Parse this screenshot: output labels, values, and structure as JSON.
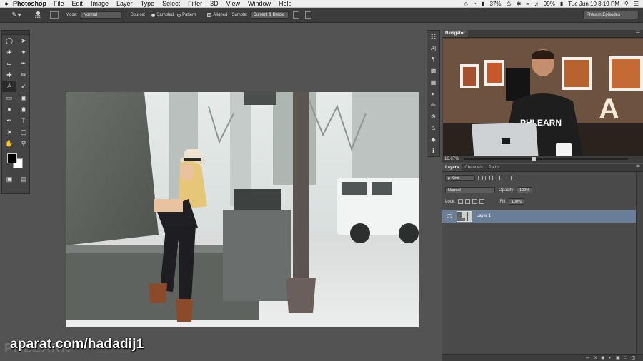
{
  "menubar": {
    "app_name": "Photoshop",
    "menus": [
      "File",
      "Edit",
      "Image",
      "Layer",
      "Type",
      "Select",
      "Filter",
      "3D",
      "View",
      "Window",
      "Help"
    ],
    "battery": "37%",
    "battery_pct2": "99%",
    "clock": "Tue Jun 10  3:19 PM"
  },
  "options": {
    "brush_size": "221",
    "mode_label": "Mode:",
    "mode_value": "Normal",
    "source_label": "Source:",
    "source_sampled": "Sampled",
    "source_pattern": "Pattern",
    "aligned_label": "Aligned",
    "sample_label": "Sample:",
    "sample_value": "Current & Below",
    "workspace": "Phlearn Episodes"
  },
  "navigator": {
    "tab": "Navigator",
    "zoom": "16.67%",
    "thumb_text": "PHLEARN",
    "letter": "A"
  },
  "layers_panel": {
    "tabs": [
      "Layers",
      "Channels",
      "Paths"
    ],
    "kind_label": "ρ Kind",
    "blend_mode": "Normal",
    "opacity_label": "Opacity:",
    "opacity_value": "100%",
    "lock_label": "Lock:",
    "fill_label": "Fill:",
    "fill_value": "100%",
    "layer_name": "Layer 1"
  },
  "watermark": {
    "text": "aparat.com/hadadij1",
    "logo": "PHLEARN"
  }
}
